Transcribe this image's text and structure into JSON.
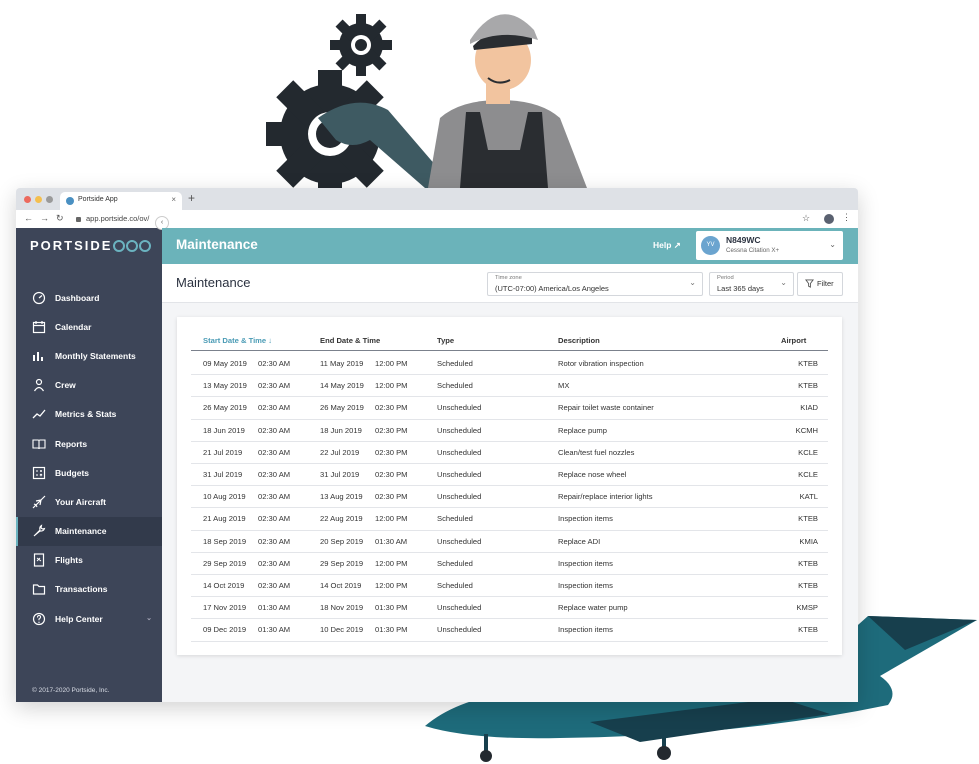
{
  "browser": {
    "tab_title": "Portside App",
    "url": "app.portside.co/ov/"
  },
  "app": {
    "logo": "PORTSIDE",
    "header_title": "Maintenance",
    "help_label": "Help",
    "account": {
      "initials": "YV",
      "tail": "N849WC",
      "model": "Cessna Citation X+"
    },
    "page_title": "Maintenance",
    "timezone": {
      "label": "Time zone",
      "value": "(UTC-07:00) America/Los Angeles"
    },
    "period": {
      "label": "Period",
      "value": "Last 365 days"
    },
    "filter_label": "Filter",
    "copyright": "© 2017-2020 Portside, Inc."
  },
  "sidebar": {
    "items": [
      {
        "label": "Dashboard",
        "icon": "gauge-icon"
      },
      {
        "label": "Calendar",
        "icon": "calendar-icon"
      },
      {
        "label": "Monthly Statements",
        "icon": "bar-chart-icon"
      },
      {
        "label": "Crew",
        "icon": "person-icon"
      },
      {
        "label": "Metrics & Stats",
        "icon": "trend-icon"
      },
      {
        "label": "Reports",
        "icon": "book-icon"
      },
      {
        "label": "Budgets",
        "icon": "calculator-icon"
      },
      {
        "label": "Your Aircraft",
        "icon": "plane-icon"
      },
      {
        "label": "Maintenance",
        "icon": "wrench-icon"
      },
      {
        "label": "Flights",
        "icon": "document-icon"
      },
      {
        "label": "Transactions",
        "icon": "folder-icon"
      },
      {
        "label": "Help Center",
        "icon": "question-icon"
      }
    ],
    "active": "Maintenance"
  },
  "table": {
    "columns": [
      "Start Date & Time",
      "End Date & Time",
      "Type",
      "Description",
      "Airport"
    ],
    "rows": [
      [
        "09 May 2019",
        "02:30 AM",
        "11 May 2019",
        "12:00 PM",
        "Scheduled",
        "Rotor vibration inspection",
        "KTEB"
      ],
      [
        "13 May 2019",
        "02:30 AM",
        "14 May 2019",
        "12:00 PM",
        "Scheduled",
        "MX",
        "KTEB"
      ],
      [
        "26 May 2019",
        "02:30 AM",
        "26 May 2019",
        "02:30 PM",
        "Unscheduled",
        "Repair toilet waste container",
        "KIAD"
      ],
      [
        "18 Jun 2019",
        "02:30 AM",
        "18 Jun 2019",
        "02:30 PM",
        "Unscheduled",
        "Replace pump",
        "KCMH"
      ],
      [
        "21 Jul 2019",
        "02:30 AM",
        "22 Jul 2019",
        "02:30 PM",
        "Unscheduled",
        "Clean/test fuel nozzles",
        "KCLE"
      ],
      [
        "31 Jul 2019",
        "02:30 AM",
        "31 Jul 2019",
        "02:30 PM",
        "Unscheduled",
        "Replace nose wheel",
        "KCLE"
      ],
      [
        "10 Aug 2019",
        "02:30 AM",
        "13 Aug 2019",
        "02:30 PM",
        "Unscheduled",
        "Repair/replace interior lights",
        "KATL"
      ],
      [
        "21 Aug 2019",
        "02:30 AM",
        "22 Aug 2019",
        "12:00 PM",
        "Scheduled",
        "Inspection items",
        "KTEB"
      ],
      [
        "18 Sep 2019",
        "02:30 AM",
        "20 Sep 2019",
        "01:30 AM",
        "Unscheduled",
        "Replace ADI",
        "KMIA"
      ],
      [
        "29 Sep 2019",
        "02:30 AM",
        "29 Sep 2019",
        "12:00 PM",
        "Scheduled",
        "Inspection items",
        "KTEB"
      ],
      [
        "14 Oct 2019",
        "02:30 AM",
        "14 Oct 2019",
        "12:00 PM",
        "Scheduled",
        "Inspection items",
        "KTEB"
      ],
      [
        "17 Nov 2019",
        "01:30 AM",
        "18 Nov 2019",
        "01:30 PM",
        "Unscheduled",
        "Replace water pump",
        "KMSP"
      ],
      [
        "09 Dec 2019",
        "01:30 AM",
        "10 Dec 2019",
        "01:30 PM",
        "Unscheduled",
        "Inspection items",
        "KTEB"
      ]
    ]
  },
  "colors": {
    "header": "#6bb3ba",
    "sidebar": "#3d4558",
    "accent": "#4a9bb5",
    "plane": "#1f6b7a"
  }
}
